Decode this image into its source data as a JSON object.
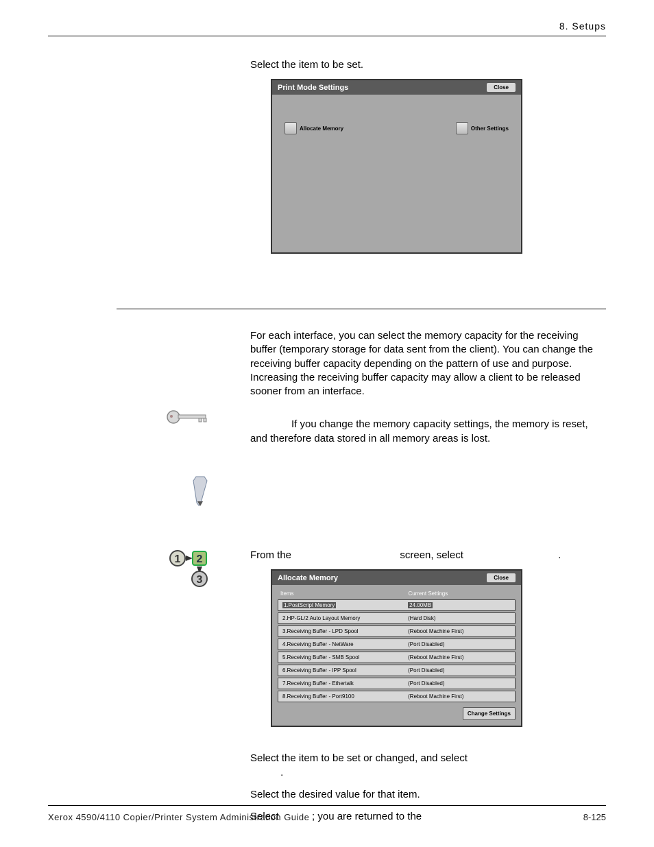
{
  "header": {
    "chapter": "8. Setups"
  },
  "intro1": "Select the item to be set.",
  "dialog1": {
    "title": "Print Mode Settings",
    "close": "Close",
    "btn_allocate": "Allocate Memory",
    "btn_other": "Other Settings"
  },
  "section1": {
    "para": "For each interface, you can select the memory capacity for the receiving buffer (temporary storage for data sent from the client).  You can change the receiving buffer capacity depending on the pattern of use and purpose.  Increasing the receiving buffer capacity may allow a client to be released sooner from an interface.",
    "keypoint": "If you change the memory capacity settings, the memory is reset, and therefore data stored in all memory areas is lost."
  },
  "step_intro_a": "From the ",
  "step_intro_b": " screen, select ",
  "step_intro_c": ".",
  "dialog2": {
    "title": "Allocate Memory",
    "close": "Close",
    "col_items": "Items",
    "col_current": "Current Settings",
    "rows": [
      {
        "item": "1.PostScript Memory",
        "val": "24.00MB"
      },
      {
        "item": "2.HP-GL/2 Auto Layout Memory",
        "val": "(Hard Disk)"
      },
      {
        "item": "3.Receiving Buffer - LPD Spool",
        "val": "(Reboot Machine First)"
      },
      {
        "item": "4.Receiving Buffer - NetWare",
        "val": "(Port Disabled)"
      },
      {
        "item": "5.Receiving Buffer - SMB Spool",
        "val": "(Reboot Machine First)"
      },
      {
        "item": "6.Receiving Buffer - IPP Spool",
        "val": "(Port Disabled)"
      },
      {
        "item": "7.Receiving Buffer - Ethertalk",
        "val": "(Port Disabled)"
      },
      {
        "item": "8.Receiving Buffer - Port9100",
        "val": "(Reboot Machine First)"
      }
    ],
    "change": "Change Settings"
  },
  "steps": {
    "s2a": "Select the item to be set or changed, and select ",
    "s2b": ".",
    "s3": "Select the desired value for that item.",
    "s4a": "Select ",
    "s4b": "; you are returned to the "
  },
  "footer": {
    "left": "Xerox 4590/4110 Copier/Printer System Administration Guide",
    "right": "8-125"
  }
}
